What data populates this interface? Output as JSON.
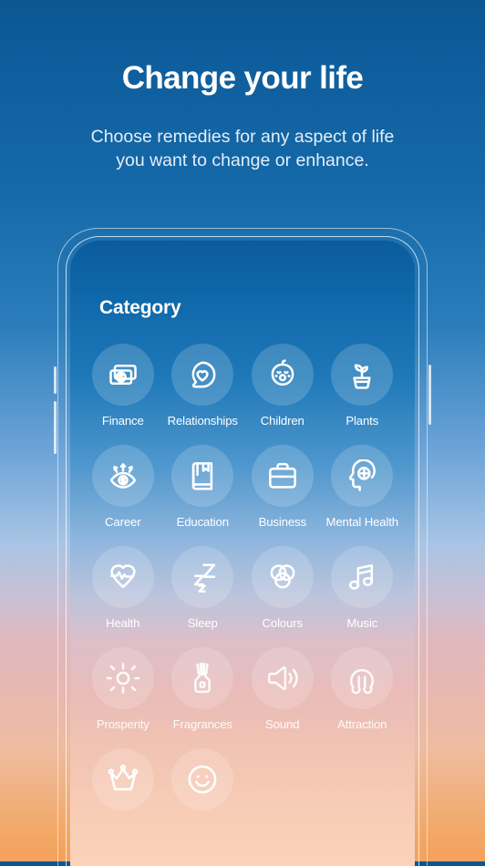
{
  "header": {
    "title": "Change your life",
    "subtitle_line1": "Choose remedies for any aspect of life",
    "subtitle_line2": "you want to change or enhance."
  },
  "colors": {
    "background_top": "#0c5693",
    "background_mid_blue": "#a8c4e4",
    "background_pink": "#dfb9bf",
    "background_bottom": "#f2a765",
    "screen_top": "#0b5c9c",
    "screen_bottom": "#fad3b9",
    "text_primary": "#ffffff",
    "text_secondary": "#e4eef8",
    "bubble_fill": "rgba(255,255,255,0.17)"
  },
  "phone": {
    "screen_title": "Category",
    "categories": [
      {
        "label": "Finance",
        "icon": "banknotes-dollar-icon"
      },
      {
        "label": "Relationships",
        "icon": "heart-speech-bubble-icon"
      },
      {
        "label": "Children",
        "icon": "baby-face-icon"
      },
      {
        "label": "Plants",
        "icon": "potted-sprout-icon"
      },
      {
        "label": "Career",
        "icon": "eye-dollar-arrows-icon"
      },
      {
        "label": "Education",
        "icon": "book-bookmark-icon"
      },
      {
        "label": "Business",
        "icon": "briefcase-icon"
      },
      {
        "label": "Mental Health",
        "icon": "head-plus-icon"
      },
      {
        "label": "Health",
        "icon": "heart-pulse-icon"
      },
      {
        "label": "Sleep",
        "icon": "zzz-sleep-icon"
      },
      {
        "label": "Colours",
        "icon": "three-circles-icon"
      },
      {
        "label": "Music",
        "icon": "music-note-icon"
      },
      {
        "label": "Prosperity",
        "icon": "sun-rays-icon"
      },
      {
        "label": "Fragrances",
        "icon": "reed-diffuser-icon"
      },
      {
        "label": "Sound",
        "icon": "speaker-waves-icon"
      },
      {
        "label": "Attraction",
        "icon": "horseshoe-magnet-icon"
      },
      {
        "label": "",
        "icon": "crown-icon"
      },
      {
        "label": "",
        "icon": "smiley-face-icon"
      }
    ],
    "side_buttons": [
      "volume-up",
      "volume-down",
      "power"
    ]
  }
}
